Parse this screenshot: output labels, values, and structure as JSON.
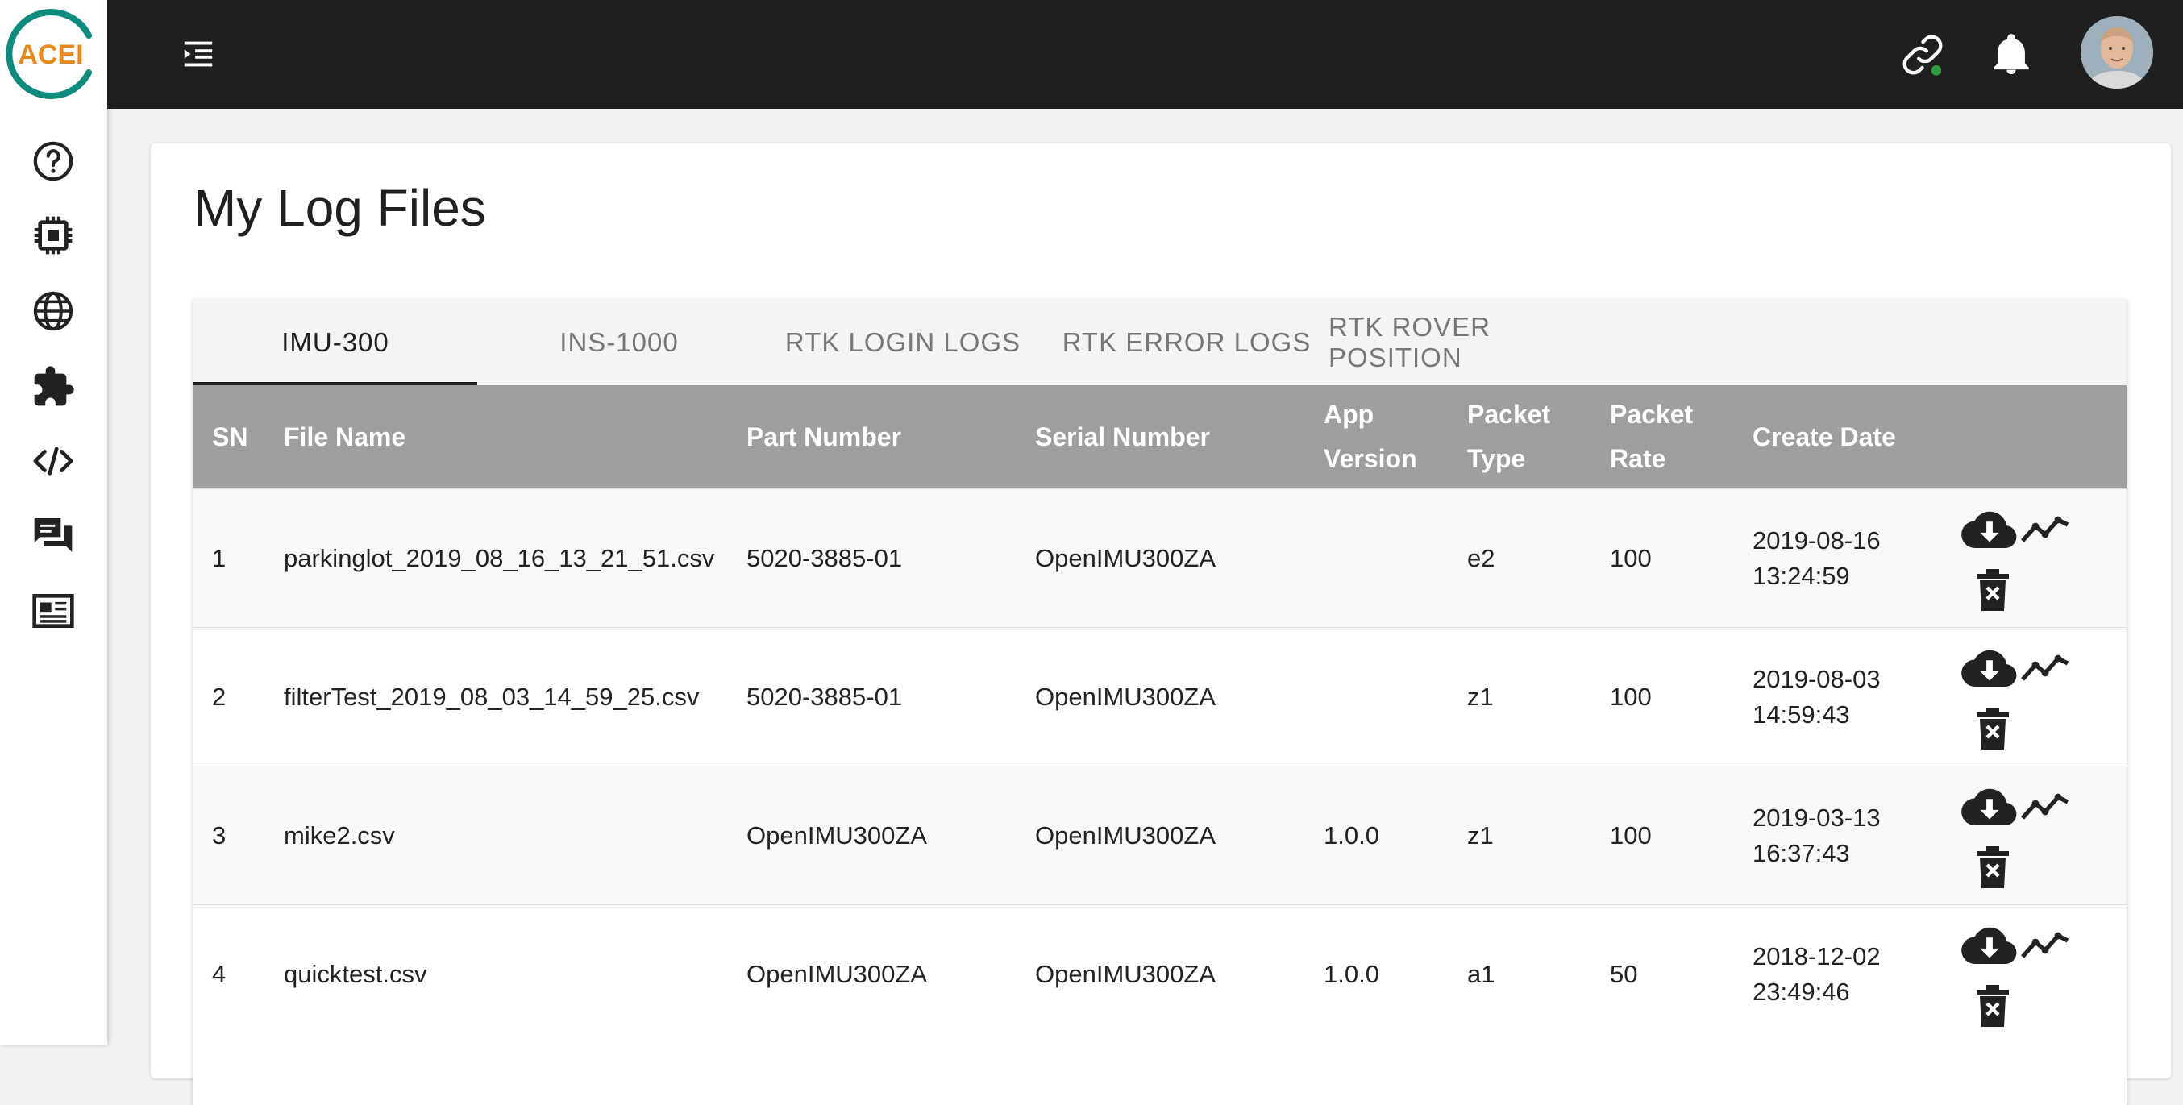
{
  "logo": {
    "text": "ACEI",
    "colors": {
      "ring": "#0f8a7e",
      "text": "#e58a1f"
    }
  },
  "sidebar": {
    "items": [
      {
        "name": "help",
        "icon": "help-circle-icon"
      },
      {
        "name": "devices",
        "icon": "chip-icon"
      },
      {
        "name": "web",
        "icon": "globe-icon"
      },
      {
        "name": "extensions",
        "icon": "puzzle-icon"
      },
      {
        "name": "code",
        "icon": "code-icon"
      },
      {
        "name": "forum",
        "icon": "chat-icon"
      },
      {
        "name": "news",
        "icon": "newspaper-icon"
      }
    ]
  },
  "header": {
    "menu_icon": "menu-collapse-icon",
    "connection_icon": "link-icon",
    "connection_status_color": "#2e9e3a",
    "notifications_icon": "bell-icon",
    "avatar": "user-avatar"
  },
  "page": {
    "title": "My Log Files"
  },
  "tabs": [
    {
      "label": "IMU-300",
      "active": true
    },
    {
      "label": "INS-1000",
      "active": false
    },
    {
      "label": "RTK LOGIN LOGS",
      "active": false
    },
    {
      "label": "RTK ERROR LOGS",
      "active": false
    },
    {
      "label": "RTK ROVER POSITION",
      "active": false
    }
  ],
  "table": {
    "columns": [
      "SN",
      "File Name",
      "Part Number",
      "Serial Number",
      "App Version",
      "Packet Type",
      "Packet Rate",
      "Create Date",
      ""
    ],
    "rows": [
      {
        "sn": "1",
        "file_name": "parkinglot_2019_08_16_13_21_51.csv",
        "part_number": "5020-3885-01",
        "serial_number": "OpenIMU300ZA",
        "app_version": "",
        "packet_type": "e2",
        "packet_rate": "100",
        "create_date": "2019-08-16",
        "create_time": "13:24:59"
      },
      {
        "sn": "2",
        "file_name": "filterTest_2019_08_03_14_59_25.csv",
        "part_number": "5020-3885-01",
        "serial_number": "OpenIMU300ZA",
        "app_version": "",
        "packet_type": "z1",
        "packet_rate": "100",
        "create_date": "2019-08-03",
        "create_time": "14:59:43"
      },
      {
        "sn": "3",
        "file_name": "mike2.csv",
        "part_number": "OpenIMU300ZA",
        "serial_number": "OpenIMU300ZA",
        "app_version": "1.0.0",
        "packet_type": "z1",
        "packet_rate": "100",
        "create_date": "2019-03-13",
        "create_time": "16:37:43"
      },
      {
        "sn": "4",
        "file_name": "quicktest.csv",
        "part_number": "OpenIMU300ZA",
        "serial_number": "OpenIMU300ZA",
        "app_version": "1.0.0",
        "packet_type": "a1",
        "packet_rate": "50",
        "create_date": "2018-12-02",
        "create_time": "23:49:46"
      }
    ],
    "row_actions": [
      "cloud-download-icon",
      "chart-line-icon",
      "delete-icon"
    ]
  }
}
